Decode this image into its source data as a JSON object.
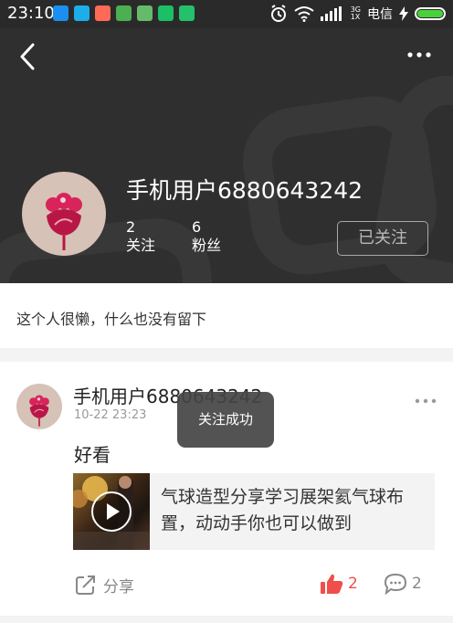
{
  "status_bar": {
    "time": "23:10",
    "network_top": "3G",
    "network_bottom": "1X",
    "carrier": "电信",
    "app_icon_colors": [
      "#1b8ff0",
      "#1baeea",
      "#ff6a57",
      "#4caf50",
      "#66bb6a",
      "#1bbf66",
      "#23c16b"
    ]
  },
  "header": {
    "profile_name": "手机用户6880643242",
    "following_count": "2",
    "following_label": "关注",
    "followers_count": "6",
    "followers_label": "粉丝",
    "follow_button_label": "已关注"
  },
  "bio": {
    "text": "这个人很懒，什么也没有留下"
  },
  "post": {
    "author": "手机用户6880643242",
    "time": "10-22 23:23",
    "text": "好看",
    "link_title": "气球造型分享学习展架氦气球布置，动动手你也可以做到",
    "share_label": "分享",
    "like_count": "2",
    "comment_count": "2"
  },
  "toast": {
    "message": "关注成功"
  },
  "colors": {
    "header_bg": "#2f2f2f",
    "accent_red": "#ee4f4a",
    "battery_green": "#48d23a"
  },
  "icons": {
    "back": "back-chevron-icon",
    "more": "more-dots-icon",
    "play": "play-icon",
    "share": "share-icon",
    "like": "thumbs-up-icon",
    "comment": "comment-icon"
  }
}
